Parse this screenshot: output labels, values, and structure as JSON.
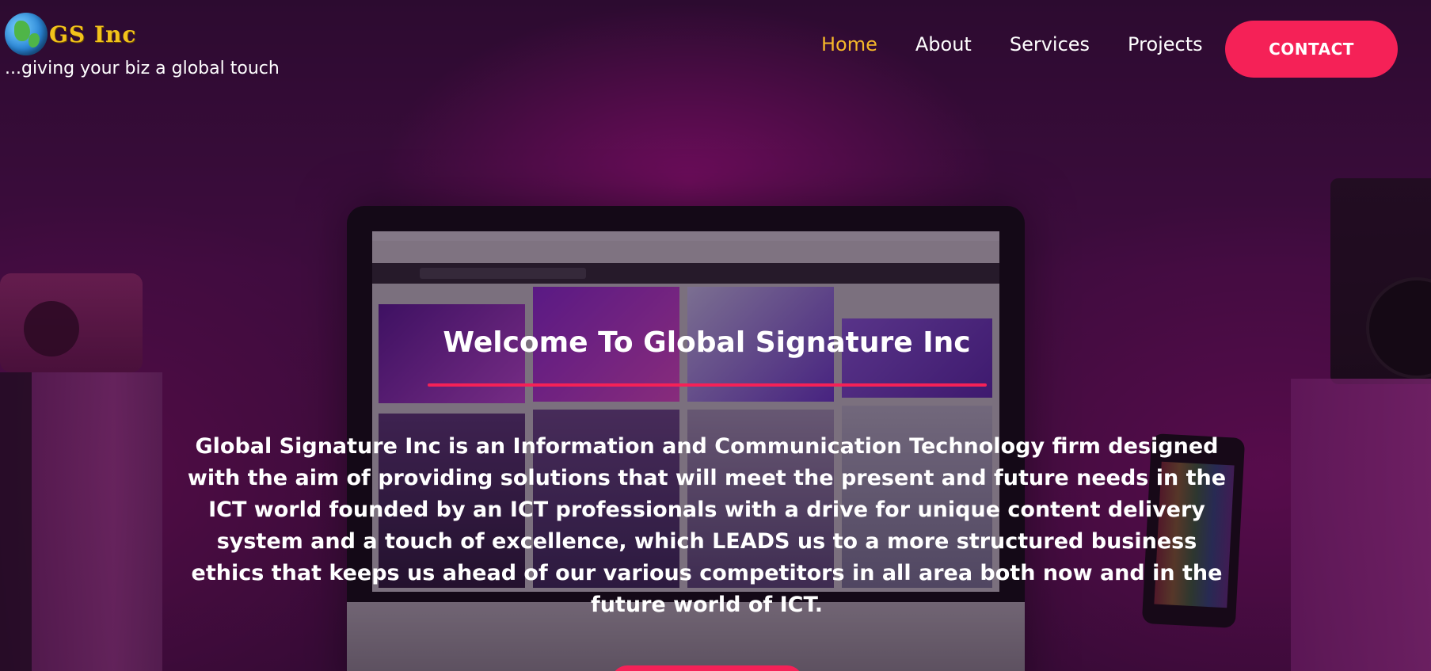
{
  "header": {
    "brand": "GS Inc",
    "tagline": "...giving your biz a global touch",
    "nav": [
      {
        "label": "Home",
        "active": true
      },
      {
        "label": "About",
        "active": false
      },
      {
        "label": "Services",
        "active": false
      },
      {
        "label": "Projects",
        "active": false
      }
    ],
    "contact_label": "CONTACT"
  },
  "hero": {
    "title": "Welcome To Global Signature Inc",
    "description": "Global Signature Inc is an Information and Communication Technology firm designed with the aim of providing solutions that will meet the present and future needs in the ICT world founded by an ICT professionals with a drive for unique content delivery system and a touch of excellence, which LEADS us to a more structured business ethics that keeps us ahead of our various competitors in all area both now and in the future world of ICT."
  },
  "colors": {
    "accent": "#f52157",
    "active_nav": "#f5b72a",
    "brand_text": "#f2c21b"
  },
  "icons": {
    "logo": "globe-icon"
  }
}
